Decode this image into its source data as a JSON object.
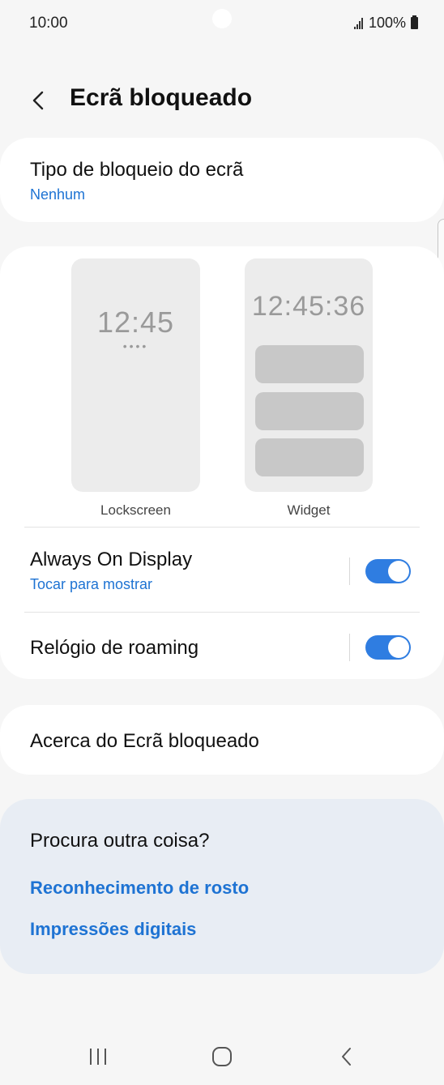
{
  "status_bar": {
    "time": "10:00",
    "battery_text": "100%",
    "icons": [
      "camera-dot",
      "signal-icon",
      "battery-icon"
    ]
  },
  "header": {
    "back_icon": "chevron-left-icon",
    "title": "Ecrã bloqueado"
  },
  "lock_type": {
    "title": "Tipo de bloqueio do ecrã",
    "value": "Nenhum"
  },
  "previews": {
    "lockscreen": {
      "clock": "12:45",
      "dots": "••••",
      "label": "Lockscreen"
    },
    "widget": {
      "clock": "12:45:36",
      "label": "Widget",
      "blocks": 3
    }
  },
  "settings": {
    "always_on": {
      "title": "Always On Display",
      "sub": "Tocar para mostrar",
      "enabled": true
    },
    "roaming_clock": {
      "title": "Relógio de roaming",
      "enabled": true
    }
  },
  "about": {
    "title": "Acerca do Ecrã bloqueado"
  },
  "suggestions": {
    "title": "Procura outra coisa?",
    "links": [
      "Reconhecimento de rosto",
      "Impressões digitais"
    ]
  },
  "navbar": {
    "icons": [
      "recent-apps-icon",
      "home-icon",
      "back-nav-icon"
    ]
  },
  "colors": {
    "accent": "#1e73d3",
    "toggle_on": "#2f7de1",
    "background": "#f6f6f6",
    "suggest_bg": "#e8edf4"
  }
}
